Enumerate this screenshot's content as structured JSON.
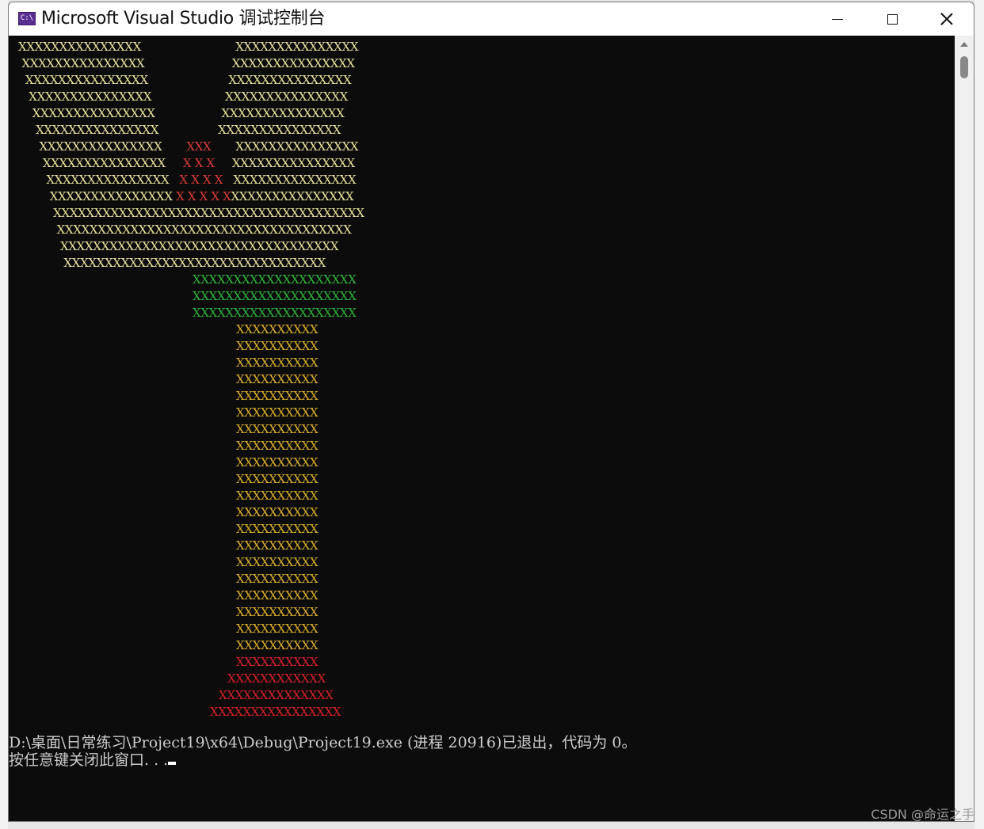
{
  "window": {
    "title": "Microsoft Visual Studio 调试控制台",
    "icon_text": "C:\\"
  },
  "console": {
    "art_lines": [
      {
        "text": "XXXXXXXXXXXXXXX                           XXXXXXXXXXXXXXX",
        "color": "yellow"
      },
      {
        "text": " XXXXXXXXXXXXXXX                         XXXXXXXXXXXXXXX",
        "color": "yellow"
      },
      {
        "text": "  XXXXXXXXXXXXXXX                       XXXXXXXXXXXXXXX",
        "color": "yellow"
      },
      {
        "text": "   XXXXXXXXXXXXXXX                     XXXXXXXXXXXXXXX",
        "color": "yellow"
      },
      {
        "text": "    XXXXXXXXXXXXXXX                   XXXXXXXXXXXXXXX",
        "color": "yellow"
      },
      {
        "text": "     XXXXXXXXXXXXXXX                 XXXXXXXXXXXXXXX",
        "color": "yellow"
      }
    ],
    "mixed_lines": [
      {
        "parts": [
          {
            "text": "      XXXXXXXXXXXXXXX       ",
            "color": "yellow"
          },
          {
            "text": "XXX",
            "color": "red"
          },
          {
            "text": "       XXXXXXXXXXXXXXX",
            "color": "yellow"
          }
        ]
      },
      {
        "parts": [
          {
            "text": "       XXXXXXXXXXXXXXX     ",
            "color": "yellow"
          },
          {
            "text": "X X X",
            "color": "red"
          },
          {
            "text": "     XXXXXXXXXXXXXXX",
            "color": "yellow"
          }
        ]
      },
      {
        "parts": [
          {
            "text": "        XXXXXXXXXXXXXXX   ",
            "color": "yellow"
          },
          {
            "text": "X X X X",
            "color": "red"
          },
          {
            "text": "   XXXXXXXXXXXXXXX",
            "color": "yellow"
          }
        ]
      },
      {
        "parts": [
          {
            "text": "         XXXXXXXXXXXXXXX ",
            "color": "yellow"
          },
          {
            "text": "X X X X X",
            "color": "red"
          },
          {
            "text": "XXXXXXXXXXXXXXX",
            "color": "yellow"
          }
        ]
      }
    ],
    "cup_lines": [
      {
        "text": "          XXXXXXXXXXXXXXXXXXXXXXXXXXXXXXXXXXXXXX",
        "color": "yellow"
      },
      {
        "text": "           XXXXXXXXXXXXXXXXXXXXXXXXXXXXXXXXXXXX",
        "color": "yellow"
      },
      {
        "text": "            XXXXXXXXXXXXXXXXXXXXXXXXXXXXXXXXXX",
        "color": "yellow"
      },
      {
        "text": "             XXXXXXXXXXXXXXXXXXXXXXXXXXXXXXXX",
        "color": "yellow"
      }
    ],
    "green_line": "XXXXXXXXXXXXXXXXXXXX",
    "green_count": 3,
    "stem_line": "XXXXXXXXXX",
    "stem_count": 20,
    "base_lines": [
      "XXXXXXXXXX",
      "XXXXXXXXXXXX",
      "XXXXXXXXXXXXXX",
      "XXXXXXXXXXXXXXXX"
    ],
    "exit_message": "D:\\桌面\\日常练习\\Project19\\x64\\Debug\\Project19.exe (进程 20916)已退出，代码为 0。",
    "prompt_message": "按任意键关闭此窗口. . ."
  },
  "watermark": "CSDN @命运之手",
  "colors": {
    "yellow": "#e7e29b",
    "red": "#d93a3a",
    "green": "#2fb33a",
    "gold": "#d9ae2a",
    "crimson": "#d8202a",
    "console_bg": "#0c0c0c"
  }
}
